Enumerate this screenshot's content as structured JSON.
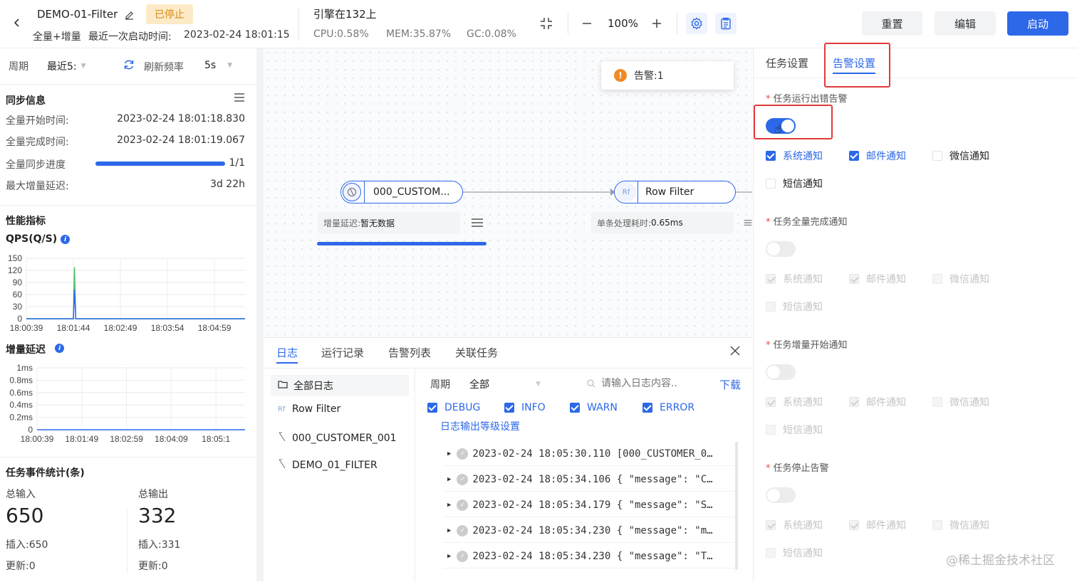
{
  "header": {
    "task_name": "DEMO-01-Filter",
    "status_badge": "已停止",
    "task_type": "全量+增量",
    "last_start_label": "最近一次启动时间:",
    "last_start_time": "2023-02-24 18:01:15",
    "engine": "引擎在132上",
    "cpu": "CPU:0.58%",
    "mem": "MEM:35.87%",
    "gc": "GC:0.08%",
    "zoom": "100%",
    "reset_label": "重置",
    "edit_label": "编辑",
    "start_label": "启动"
  },
  "left": {
    "period_label": "周期",
    "period_value": "最近5:",
    "refresh_label": "刷新频率",
    "refresh_value": "5s",
    "sync_title": "同步信息",
    "full_start_label": "全量开始时间:",
    "full_start_value": "2023-02-24 18:01:18.830",
    "full_end_label": "全量完成时间:",
    "full_end_value": "2023-02-24 18:01:19.067",
    "progress_label": "全量同步进度",
    "progress_value": "1/1",
    "progress_fraction": 1.0,
    "max_delay_label": "最大增量延迟:",
    "max_delay_value": "3d 22h",
    "perf_title": "性能指标",
    "qps_title": "QPS(Q/S)",
    "delay_title": "增量延迟",
    "stats_title": "任务事件统计(条)",
    "total_in_label": "总输入",
    "total_in_value": "650",
    "total_out_label": "总输出",
    "total_out_value": "332",
    "insert_in": "插入:650",
    "insert_out": "插入:331",
    "update_in": "更新:0",
    "update_out": "更新:0"
  },
  "chart_data": [
    {
      "type": "line",
      "title": "QPS(Q/S)",
      "x": [
        "18:00:39",
        "18:01:44",
        "18:02:49",
        "18:03:54",
        "18:04:59"
      ],
      "y_ticks": [
        "150",
        "120",
        "90",
        "60",
        "30",
        "0"
      ],
      "ylim": [
        0,
        150
      ],
      "series": [
        {
          "color": "#4fbf6a",
          "points": [
            [
              0,
              0
            ],
            [
              0.215,
              0
            ],
            [
              0.22,
              128
            ],
            [
              0.226,
              0
            ],
            [
              1,
              0
            ]
          ]
        },
        {
          "color": "#2c68e8",
          "points": [
            [
              0,
              0
            ],
            [
              0.215,
              0
            ],
            [
              0.22,
              72
            ],
            [
              0.226,
              0
            ],
            [
              1,
              0
            ]
          ]
        }
      ]
    },
    {
      "type": "line",
      "title": "增量延迟",
      "x": [
        "18:00:39",
        "18:01:49",
        "18:02:59",
        "18:04:09",
        "18:05:1"
      ],
      "y_ticks": [
        "1ms",
        "0.8ms",
        "0.6ms",
        "0.4ms",
        "0.2ms",
        "0"
      ],
      "ylim": [
        0,
        1
      ],
      "series": [
        {
          "color": "#2c68e8",
          "points": [
            [
              0,
              0
            ],
            [
              1,
              0
            ]
          ]
        }
      ]
    }
  ],
  "canvas": {
    "alert_label": "告警:1",
    "source_node": "000_CUSTOM...",
    "source_info_label": "增量延迟:",
    "source_info_value": "暂无数据",
    "target_node_icon": "Rf",
    "target_node": "Row Filter",
    "target_info_label": "单条处理耗时:",
    "target_info_value": "0.65ms"
  },
  "logs": {
    "tabs": [
      "日志",
      "运行记录",
      "告警列表",
      "关联任务"
    ],
    "tree": [
      {
        "icon": "folder-icon",
        "label": "全部日志"
      },
      {
        "icon": "rf-icon",
        "label": "Row Filter"
      },
      {
        "icon": "source-icon",
        "label": "000_CUSTOMER_001"
      },
      {
        "icon": "source-icon",
        "label": "DEMO_01_FILTER"
      }
    ],
    "rf_badge": "Rf",
    "period_label": "周期",
    "period_value": "全部",
    "search_placeholder": "请输入日志内容..",
    "download_label": "下载",
    "levels": [
      "DEBUG",
      "INFO",
      "WARN",
      "ERROR"
    ],
    "level_setting_link": "日志输出等级设置",
    "rows": [
      "2023-02-24 18:05:30.110 [000_CUSTOMER_0…",
      "2023-02-24 18:05:34.106 { \"message\": \"C…",
      "2023-02-24 18:05:34.179 { \"message\": \"S…",
      "2023-02-24 18:05:34.230 { \"message\": \"m…",
      "2023-02-24 18:05:34.230 { \"message\": \"T…"
    ]
  },
  "settings": {
    "tab_task": "任务设置",
    "tab_alert": "告警设置",
    "sections": [
      {
        "title": "任务运行出错告警",
        "enabled": true
      },
      {
        "title": "任务全量完成通知",
        "enabled": false
      },
      {
        "title": "任务增量开始通知",
        "enabled": false
      },
      {
        "title": "任务停止告警",
        "enabled": false
      }
    ],
    "opt_system": "系统通知",
    "opt_email": "邮件通知",
    "opt_wechat": "微信通知",
    "opt_sms": "短信通知"
  },
  "watermark": "@稀土掘金技术社区"
}
